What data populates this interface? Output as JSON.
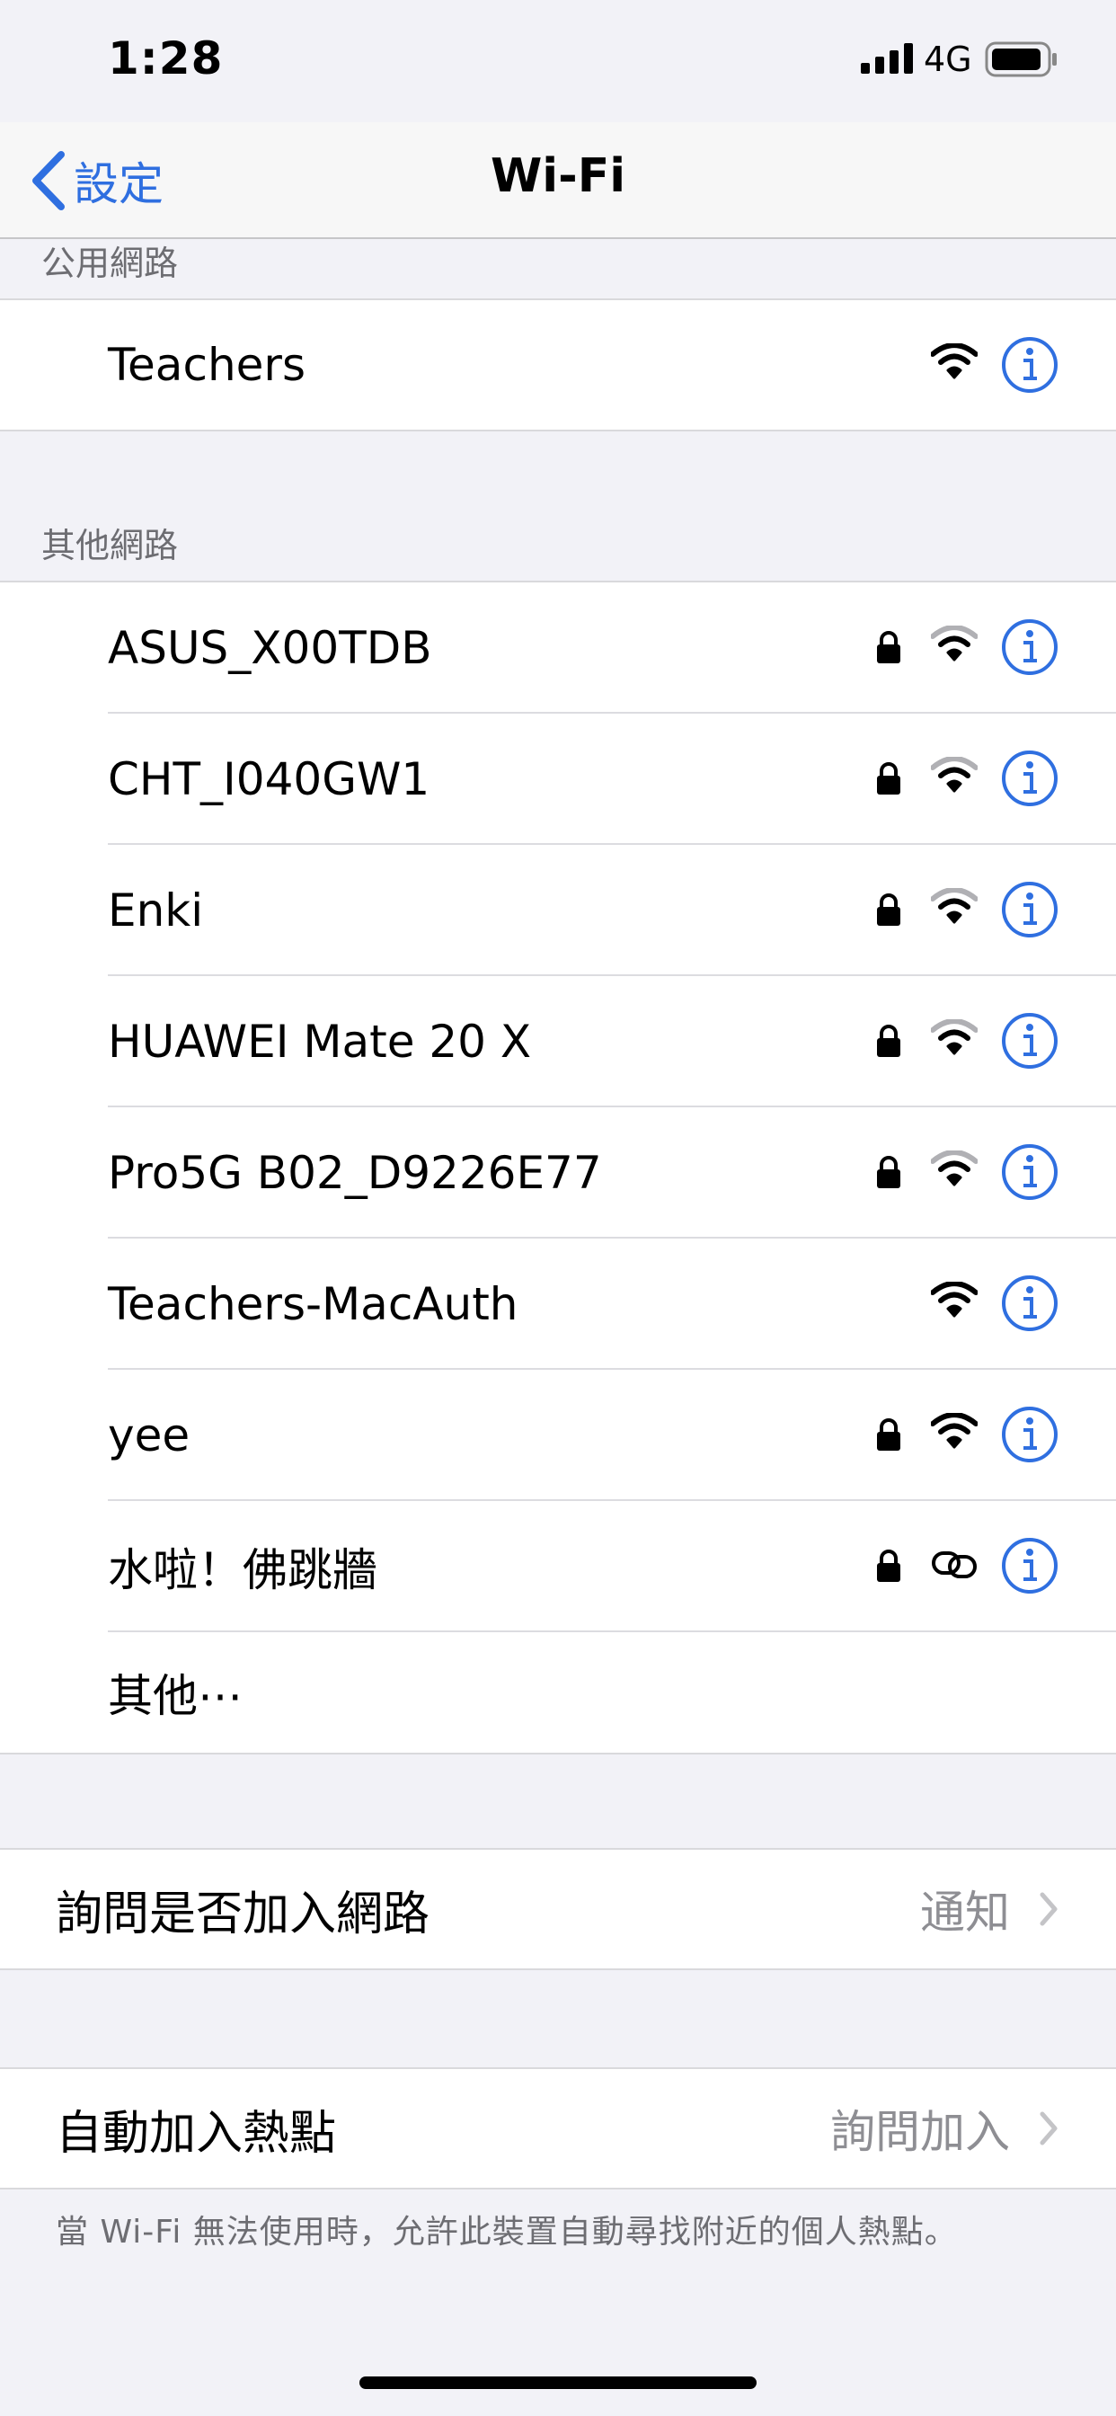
{
  "status_bar": {
    "time": "1:28",
    "network_type": "4G",
    "icons": [
      "signal-bars-icon",
      "battery-icon"
    ]
  },
  "nav": {
    "back_label": "設定",
    "title": "Wi-Fi"
  },
  "public_section": {
    "header": "公用網路",
    "networks": [
      {
        "name": "Teachers",
        "secured": false,
        "icon": "wifi-icon"
      }
    ]
  },
  "other_section": {
    "header": "其他網路",
    "networks": [
      {
        "name": "ASUS_X00TDB",
        "secured": true,
        "icon": "wifi-icon"
      },
      {
        "name": "CHT_I040GW1",
        "secured": true,
        "icon": "wifi-icon"
      },
      {
        "name": "Enki",
        "secured": true,
        "icon": "wifi-icon"
      },
      {
        "name": "HUAWEI Mate 20 X",
        "secured": true,
        "icon": "wifi-icon"
      },
      {
        "name": "Pro5G B02_D9226E77",
        "secured": true,
        "icon": "wifi-icon"
      },
      {
        "name": "Teachers-MacAuth",
        "secured": false,
        "icon": "wifi-icon"
      },
      {
        "name": "yee",
        "secured": true,
        "icon": "wifi-icon"
      },
      {
        "name": "水啦！佛跳牆",
        "secured": true,
        "icon": "personal-hotspot-link-icon"
      }
    ],
    "other_label": "其他⋯"
  },
  "ask_to_join": {
    "label": "詢問是否加入網路",
    "value": "通知"
  },
  "auto_join_hotspot": {
    "label": "自動加入熱點",
    "value": "詢問加入",
    "note": "當 Wi-Fi 無法使用時，允許此裝置自動尋找附近的個人熱點。"
  },
  "colors": {
    "accent": "#2f6fe0",
    "background": "#f2f2f7",
    "secondary_text": "#8e8e93"
  }
}
